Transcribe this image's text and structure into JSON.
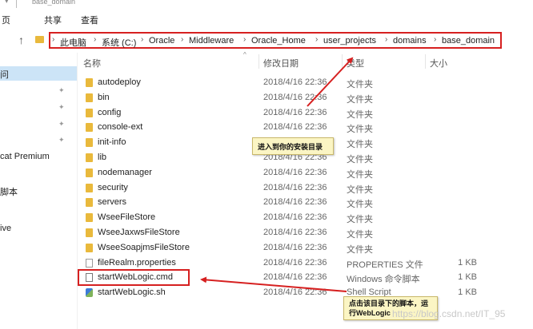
{
  "window": {
    "title": "base_domain"
  },
  "ribbon": {
    "tabs": [
      "页",
      "共享",
      "查看"
    ]
  },
  "breadcrumb": [
    "此电脑",
    "系统 (C:)",
    "Oracle",
    "Middleware",
    "Oracle_Home",
    "user_projects",
    "domains",
    "base_domain"
  ],
  "nav": {
    "items": [
      "问",
      "cat Premium",
      "脚本",
      "ive"
    ]
  },
  "columns": {
    "name": "名称",
    "date": "修改日期",
    "type": "类型",
    "size": "大小"
  },
  "files": [
    {
      "name": "autodeploy",
      "date": "2018/4/16 22:36",
      "type": "文件夹",
      "size": "",
      "icon": "folder-icon"
    },
    {
      "name": "bin",
      "date": "2018/4/16 22:36",
      "type": "文件夹",
      "size": "",
      "icon": "folder-icon"
    },
    {
      "name": "config",
      "date": "2018/4/16 22:36",
      "type": "文件夹",
      "size": "",
      "icon": "folder-icon"
    },
    {
      "name": "console-ext",
      "date": "2018/4/16 22:36",
      "type": "文件夹",
      "size": "",
      "icon": "folder-icon"
    },
    {
      "name": "init-info",
      "date": "2018/4/16 22:36",
      "type": "文件夹",
      "size": "",
      "icon": "folder-icon"
    },
    {
      "name": "lib",
      "date": "2018/4/16 22:36",
      "type": "文件夹",
      "size": "",
      "icon": "folder-icon"
    },
    {
      "name": "nodemanager",
      "date": "2018/4/16 22:36",
      "type": "文件夹",
      "size": "",
      "icon": "folder-icon"
    },
    {
      "name": "security",
      "date": "2018/4/16 22:36",
      "type": "文件夹",
      "size": "",
      "icon": "folder-icon"
    },
    {
      "name": "servers",
      "date": "2018/4/16 22:36",
      "type": "文件夹",
      "size": "",
      "icon": "folder-icon"
    },
    {
      "name": "WseeFileStore",
      "date": "2018/4/16 22:36",
      "type": "文件夹",
      "size": "",
      "icon": "folder-icon"
    },
    {
      "name": "WseeJaxwsFileStore",
      "date": "2018/4/16 22:36",
      "type": "文件夹",
      "size": "",
      "icon": "folder-icon"
    },
    {
      "name": "WseeSoapjmsFileStore",
      "date": "2018/4/16 22:36",
      "type": "文件夹",
      "size": "",
      "icon": "folder-icon"
    },
    {
      "name": "fileRealm.properties",
      "date": "2018/4/16 22:36",
      "type": "PROPERTIES 文件",
      "size": "1 KB",
      "icon": "file-icon"
    },
    {
      "name": "startWebLogic.cmd",
      "date": "2018/4/16 22:36",
      "type": "Windows 命令脚本",
      "size": "1 KB",
      "icon": "cmd-icon"
    },
    {
      "name": "startWebLogic.sh",
      "date": "2018/4/16 22:36",
      "type": "Shell Script",
      "size": "1 KB",
      "icon": "shell-script-icon"
    }
  ],
  "annotations": {
    "install_dir": "进入到你的安装目录",
    "run_script": "点击该目录下的脚本，运行WebLogic"
  },
  "watermark": "https://blog.csdn.net/IT_95"
}
